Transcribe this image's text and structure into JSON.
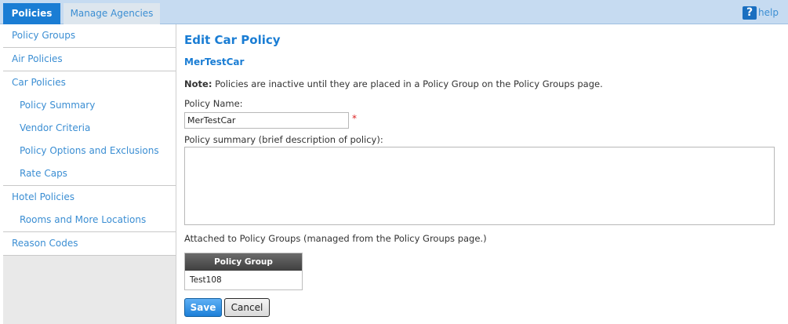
{
  "tabs": {
    "policies": "Policies",
    "manage_agencies": "Manage Agencies"
  },
  "help": {
    "icon": "?",
    "label": "help"
  },
  "sidebar": {
    "policy_groups": "Policy Groups",
    "air_policies": "Air Policies",
    "car_policies": "Car Policies",
    "car_sub": [
      "Policy Summary",
      "Vendor Criteria",
      "Policy Options and Exclusions",
      "Rate Caps"
    ],
    "hotel_policies": "Hotel Policies",
    "hotel_sub": [
      "Rooms and More Locations"
    ],
    "reason_codes": "Reason Codes"
  },
  "main": {
    "title": "Edit Car Policy",
    "subtitle": "MerTestCar",
    "note_label": "Note:",
    "note_text": " Policies are inactive until they are placed in a Policy Group on the Policy Groups page.",
    "policy_name_label": "Policy Name:",
    "policy_name_value": "MerTestCar",
    "required_mark": "*",
    "summary_label": "Policy summary (brief description of policy):",
    "summary_value": "",
    "attached_label": "Attached to Policy Groups (managed from the Policy Groups page.)",
    "table_header": "Policy Group",
    "table_rows": [
      "Test108"
    ],
    "save_label": "Save",
    "cancel_label": "Cancel"
  },
  "colors": {
    "accent": "#1a7dd4",
    "link": "#3b8ed3",
    "topbar": "#c6dbf1",
    "required": "#dd2222"
  }
}
